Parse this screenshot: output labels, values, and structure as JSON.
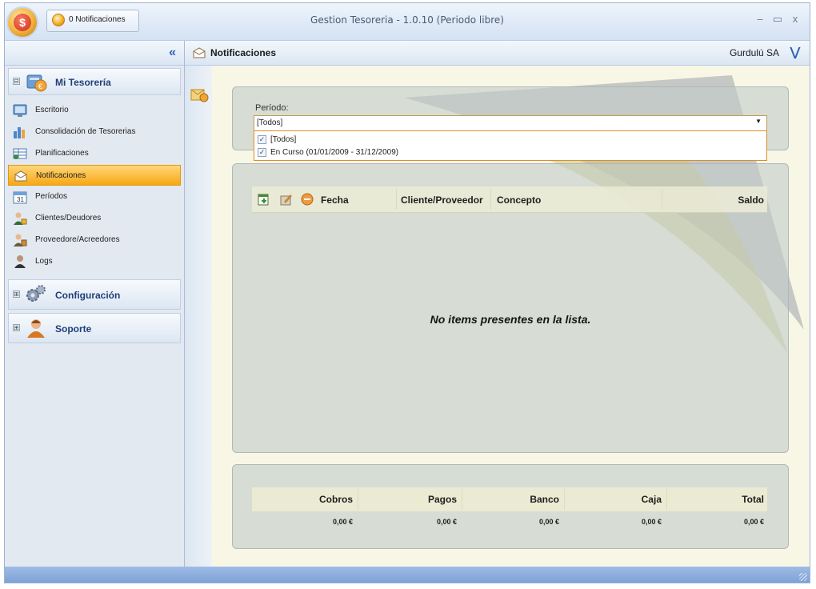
{
  "window": {
    "title": "Gestion Tesoreria - 1.0.10 (Periodo libre)",
    "notifications_button": "0 Notificaciones",
    "controls": {
      "minimize": "–",
      "maximize": "▭",
      "close": "x"
    }
  },
  "sidebar": {
    "collapse_glyph": "«",
    "groups": [
      {
        "label": "Mi Tesorería",
        "icon": "treasury-icon",
        "toggle": "⊟"
      },
      {
        "label": "Configuración",
        "icon": "gears-icon",
        "toggle": "⊞"
      },
      {
        "label": "Soporte",
        "icon": "support-agent-icon",
        "toggle": "⊞"
      }
    ],
    "items": [
      {
        "label": "Escritorio",
        "icon": "desktop-icon",
        "selected": false
      },
      {
        "label": "Consolidación de Tesorerias",
        "icon": "bar-chart-icon",
        "selected": false
      },
      {
        "label": "Planificaciones",
        "icon": "planning-icon",
        "selected": false
      },
      {
        "label": "Notificaciones",
        "icon": "notifications-icon",
        "selected": true
      },
      {
        "label": "Períodos",
        "icon": "calendar-icon",
        "selected": false
      },
      {
        "label": "Clientes/Deudores",
        "icon": "clients-icon",
        "selected": false
      },
      {
        "label": "Proveedore/Acreedores",
        "icon": "suppliers-icon",
        "selected": false
      },
      {
        "label": "Logs",
        "icon": "logs-icon",
        "selected": false
      }
    ]
  },
  "header": {
    "title": "Notificaciones",
    "company": "Gurdulú SA",
    "expand_glyph": "»"
  },
  "period_filter": {
    "label": "Período:",
    "value": "[Todos]",
    "options": [
      {
        "label": "[Todos]",
        "checked": true
      },
      {
        "label": "En Curso (01/01/2009 - 31/12/2009)",
        "checked": true
      }
    ]
  },
  "list": {
    "columns": [
      "Fecha",
      "Cliente/Proveedor",
      "Concepto",
      "Saldo"
    ],
    "toolbar_icons": [
      "add-icon",
      "edit-icon",
      "delete-icon"
    ],
    "empty_message": "No items presentes en la lista."
  },
  "totals": {
    "columns": [
      "Cobros",
      "Pagos",
      "Banco",
      "Caja",
      "Total"
    ],
    "values": [
      "0,00 €",
      "0,00 €",
      "0,00 €",
      "0,00 €",
      "0,00 €"
    ]
  },
  "colors": {
    "selection": "#f7a814",
    "accent_blue": "#2d5fb0",
    "statusbar": "#8fb0e0"
  }
}
